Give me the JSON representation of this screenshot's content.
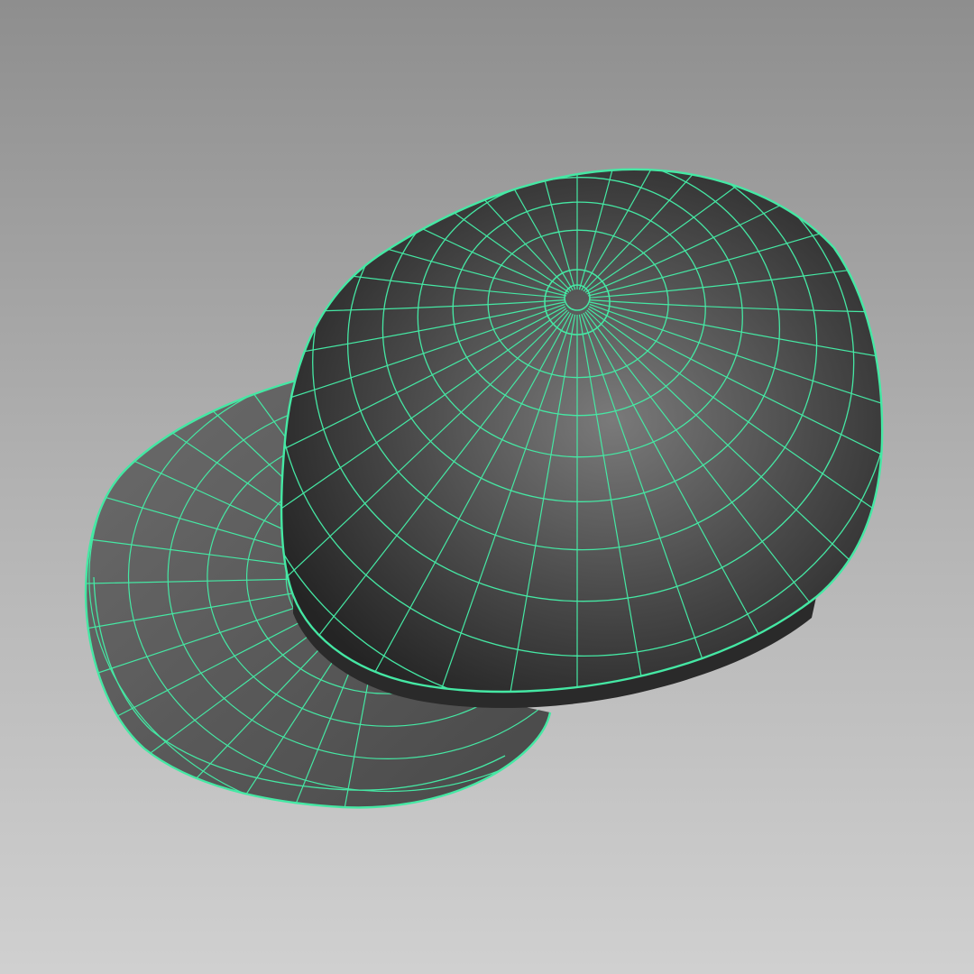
{
  "viewport": {
    "background": {
      "top": "#8e8e8e",
      "middle": "#b2b2b2",
      "bottom": "#d0d0d0"
    }
  },
  "model": {
    "object": "baseball-cap",
    "display_mode": "wireframe-on-shaded",
    "colors": {
      "wireframe": "#45e8a4",
      "crown_light": "#7a7a7a",
      "crown_mid": "#4a4a4a",
      "crown_dark": "#242424",
      "brim_top": "#6c6c6c",
      "brim_edge": "#484848",
      "band": "#2a2a2a"
    }
  }
}
